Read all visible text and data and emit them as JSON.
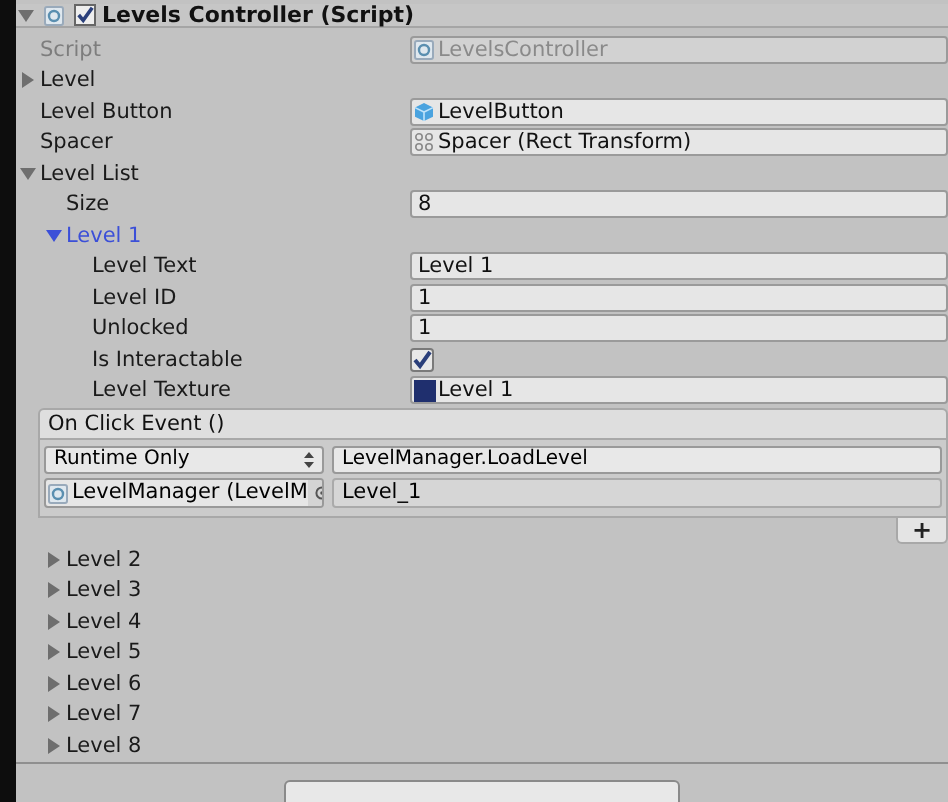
{
  "component": {
    "title": "Levels Controller (Script)",
    "enabled": true,
    "expanded": true
  },
  "fields": [
    {
      "kind": "script-ref",
      "label": "Script",
      "value": "LevelsController",
      "disabled": true
    },
    {
      "kind": "foldout",
      "label": "Level",
      "expanded": false,
      "disabled": false
    },
    {
      "kind": "prefab-ref",
      "label": "Level Button",
      "value": "LevelButton",
      "disabled": false
    },
    {
      "kind": "transform-ref",
      "label": "Spacer",
      "value": "Spacer (Rect Transform)",
      "disabled": false
    },
    {
      "kind": "foldout",
      "label": "Level List",
      "expanded": true,
      "disabled": false,
      "children": [
        {
          "kind": "text",
          "label": "Size",
          "value": "8"
        },
        {
          "kind": "foldout",
          "label": "Level 1",
          "expanded": true,
          "selected": true,
          "children": [
            {
              "kind": "text",
              "label": "Level Text",
              "value": "Level 1"
            },
            {
              "kind": "text",
              "label": "Level ID",
              "value": "1"
            },
            {
              "kind": "text",
              "label": "Unlocked",
              "value": "1"
            },
            {
              "kind": "checkbox",
              "label": "Is Interactable",
              "checked": true
            },
            {
              "kind": "texture-ref",
              "label": "Level Texture",
              "value": "Level 1"
            }
          ],
          "event": {
            "title": "On Click Event ()",
            "mode": "Runtime Only",
            "function": "LevelManager.LoadLevel",
            "target": "LevelManager (LevelM",
            "argument": "Level_1",
            "add_label": "+"
          }
        },
        {
          "kind": "foldout",
          "label": "Level 2",
          "expanded": false,
          "selected": false
        },
        {
          "kind": "foldout",
          "label": "Level 3",
          "expanded": false,
          "selected": false
        },
        {
          "kind": "foldout",
          "label": "Level 4",
          "expanded": false,
          "selected": false
        },
        {
          "kind": "foldout",
          "label": "Level 5",
          "expanded": false,
          "selected": false
        },
        {
          "kind": "foldout",
          "label": "Level 6",
          "expanded": false,
          "selected": false
        },
        {
          "kind": "foldout",
          "label": "Level 7",
          "expanded": false,
          "selected": false
        },
        {
          "kind": "foldout",
          "label": "Level 8",
          "expanded": false,
          "selected": false
        }
      ]
    }
  ]
}
